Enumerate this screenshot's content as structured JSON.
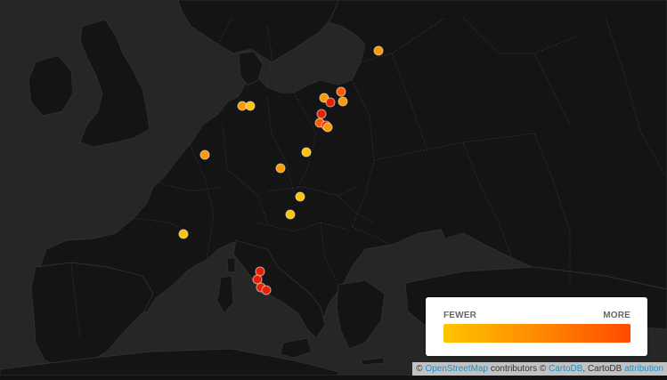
{
  "legend": {
    "low_label": "FEWER",
    "high_label": "MORE",
    "colors": [
      "#ffc400",
      "#ff8a00",
      "#ff4a00"
    ]
  },
  "attribution": {
    "prefix": "©",
    "osm_link": "OpenStreetMap",
    "contributors": "contributors ©",
    "carto_link": "CartoDB",
    "carto_suffix": ", CartoDB",
    "attribution_link": "attribution"
  },
  "map": {
    "background_color": "#262626",
    "land_color": "#141414",
    "marker_colors": {
      "few": "#ffc400",
      "some": "#ff9900",
      "many": "#ff5a00",
      "most": "#e62000"
    }
  }
}
